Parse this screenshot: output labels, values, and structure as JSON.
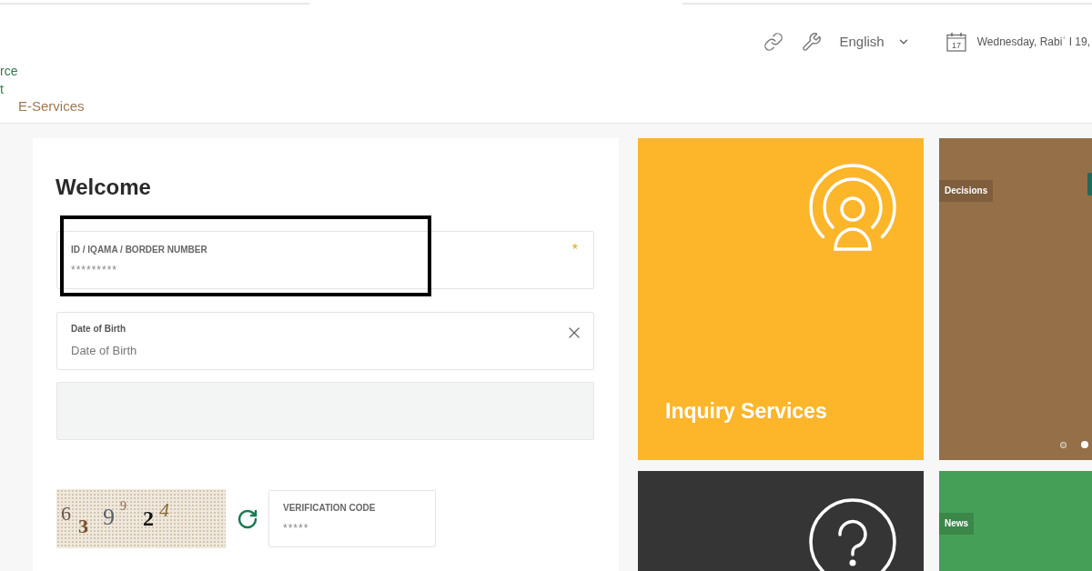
{
  "header": {
    "logo_lines": [
      "rce",
      "t"
    ],
    "logo_subtitle": "E-Services",
    "language": "English",
    "calendar_day": "17",
    "date": "Wednesday, Rabiʿ I 19,"
  },
  "login": {
    "title": "Welcome",
    "fields": [
      {
        "kind": "text",
        "label": "ID / IQAMA / BORDER NUMBER",
        "value": "*********",
        "required_mark": "*",
        "highlighted": true
      },
      {
        "kind": "date",
        "label": "Date of Birth",
        "placeholder": "Date of Birth",
        "clearable": true
      },
      {
        "kind": "blank"
      }
    ],
    "captcha": {
      "characters": [
        "6",
        "3",
        "9",
        "9",
        "2",
        "4"
      ]
    },
    "verification": {
      "label": "VERIFICATION CODE",
      "value": "*****"
    }
  },
  "tiles": [
    {
      "kind": "service",
      "color": "#fdb52a",
      "title": "Inquiry Services"
    },
    {
      "kind": "feed",
      "color": "#946f48",
      "tag": "Decisions",
      "side_tab": true,
      "dots": [
        {
          "selected": false
        },
        {
          "selected": true
        }
      ]
    },
    {
      "kind": "service",
      "color": "#353535"
    },
    {
      "kind": "feed",
      "color": "#469f56",
      "tag": "News"
    }
  ]
}
